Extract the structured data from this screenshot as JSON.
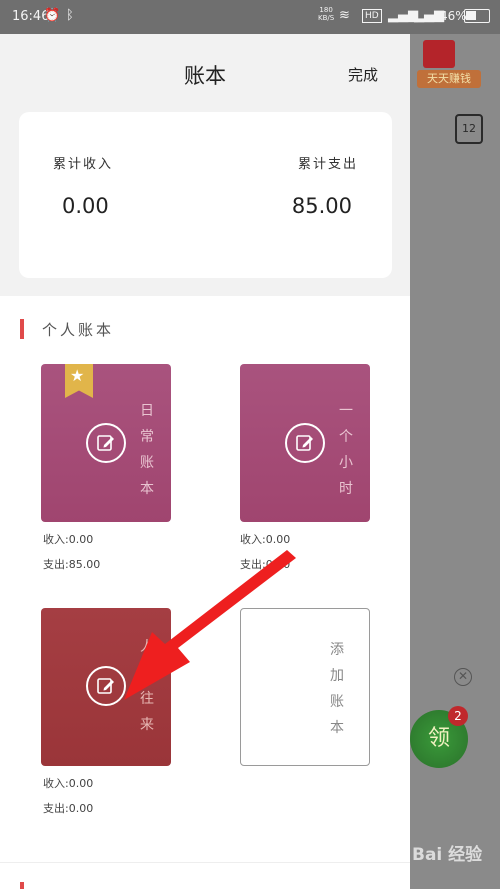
{
  "status_bar": {
    "time": "16:46",
    "net_speed": "180",
    "net_unit": "KB/S",
    "hd_label": "HD",
    "battery_pct": "46%"
  },
  "header": {
    "title": "账本",
    "done_label": "完成"
  },
  "summary": {
    "income_label": "累计收入",
    "income_value": "0.00",
    "expense_label": "累计支出",
    "expense_value": "85.00"
  },
  "section": {
    "title": "个人账本"
  },
  "books": [
    {
      "title": "日常账本",
      "income": "收入:0.00",
      "expense": "支出:85.00",
      "color": "#a44a76",
      "favorite": true
    },
    {
      "title": "一个小时",
      "income": "收入:0.00",
      "expense": "支出:0.00",
      "color": "#a44a76"
    },
    {
      "title": "人情往来",
      "income": "收入:0.00",
      "expense": "支出:0.00",
      "color": "#a03a3e"
    }
  ],
  "add_book": {
    "title": "添加账本"
  },
  "background_app": {
    "banner_label": "天天赚钱",
    "calendar_day": "12",
    "coin_label": "领",
    "badge_count": "2",
    "watermark": "Bai 经验"
  },
  "colors": {
    "accent": "#e04a4a",
    "arrow": "#ee1f1f"
  }
}
